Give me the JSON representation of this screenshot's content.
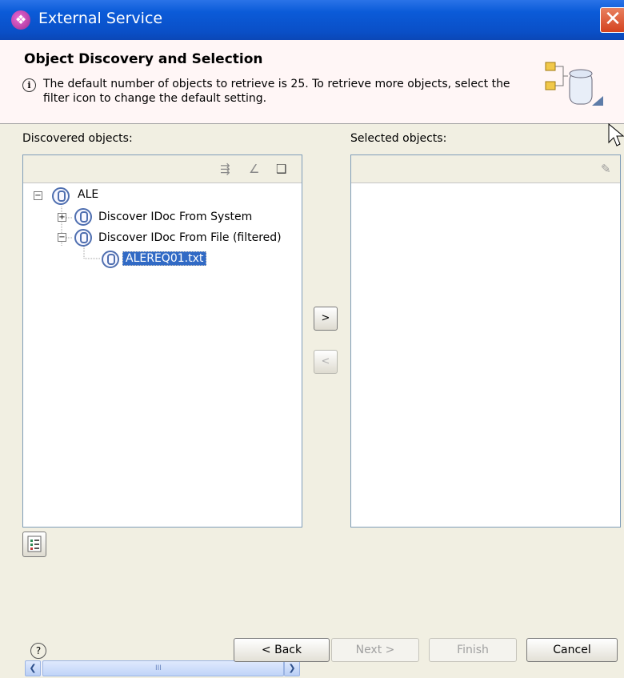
{
  "window": {
    "title": "External Service",
    "close_glyph": "✕",
    "title_glyph": "❖"
  },
  "header": {
    "title": "Object Discovery and Selection",
    "message": "The default number of objects to retrieve is 25.  To retrieve more objects, select the filter icon to change the default setting.",
    "info_glyph": "i"
  },
  "left": {
    "label": "Discovered objects:",
    "toolbar_icons": [
      "filter-icon",
      "edit-icon",
      "book-icon"
    ],
    "tree": [
      {
        "label": "ALE",
        "expander": "−"
      },
      {
        "label": "Discover IDoc From System",
        "expander": "+"
      },
      {
        "label": "Discover IDoc From File (filtered)",
        "expander": "−"
      },
      {
        "label": "ALEREQ01.txt",
        "selected": true
      }
    ],
    "scroll_left": "❮",
    "scroll_right": "❯",
    "grip": "III"
  },
  "transfer": {
    "add_glyph": ">",
    "remove_glyph": "<"
  },
  "right": {
    "label": "Selected objects:",
    "edit_icon_glyph": "✎"
  },
  "buttons": {
    "back": "< Back",
    "next": "Next >",
    "finish": "Finish",
    "cancel": "Cancel",
    "help_glyph": "?"
  },
  "colors": {
    "titlebar": "#0b5bd8",
    "selection": "#316ac5",
    "header_bg": "#fff6f6"
  }
}
